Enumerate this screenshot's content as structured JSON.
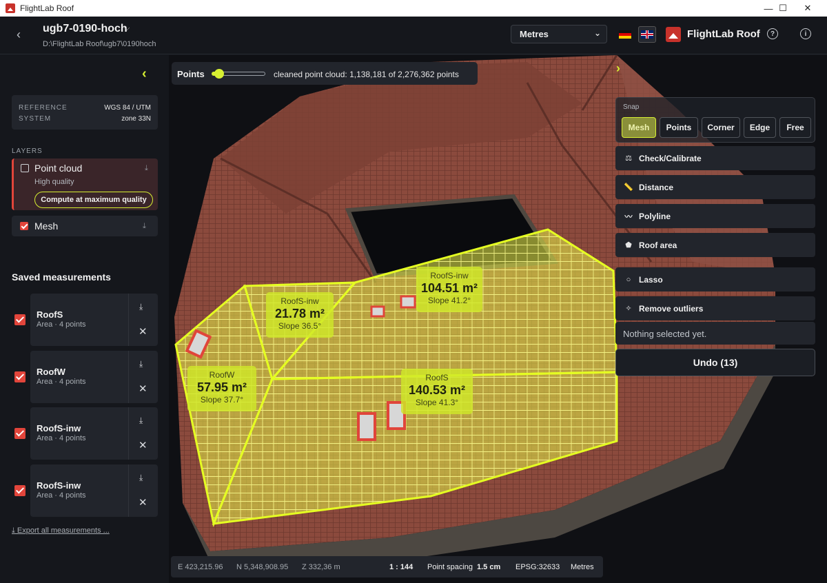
{
  "window": {
    "title": "FlightLab Roof",
    "minimize": "—",
    "maximize": "☐",
    "close": "✕"
  },
  "header": {
    "back": "‹",
    "project_name": "ugb7-0190-hoch",
    "project_caret": "⌵",
    "project_path": "D:\\FlightLab Roof\\ugb7\\0190hoch",
    "units_value": "Metres",
    "brand_name": "FlightLab Roof",
    "help_icon": "?",
    "info_icon": "i"
  },
  "left": {
    "collapse_icon": "‹",
    "reference": {
      "label_1": "REFERENCE",
      "label_2": "SYSTEM",
      "value_1": "WGS 84 / UTM",
      "value_2": "zone 33N"
    },
    "layers_label": "LAYERS",
    "point_cloud": {
      "title": "Point cloud",
      "quality": "High quality",
      "compute_label": "Compute at maximum quality",
      "checked": false
    },
    "mesh": {
      "title": "Mesh",
      "checked": true
    },
    "saved_title": "Saved measurements",
    "measurements": [
      {
        "name": "RoofS",
        "desc": "Area · 4 points"
      },
      {
        "name": "RoofW",
        "desc": "Area · 4 points"
      },
      {
        "name": "RoofS-inw",
        "desc": "Area · 4 points"
      },
      {
        "name": "RoofS-inw",
        "desc": "Area · 4 points"
      }
    ],
    "export_label": "⤓ Export all measurements ..."
  },
  "points_bar": {
    "label": "Points",
    "text": "cleaned point cloud: 1,138,181 of 2,276,362 points",
    "slider_fraction": 0.1
  },
  "snap": {
    "label": "Snap",
    "options": [
      "Mesh",
      "Points",
      "Corner",
      "Edge",
      "Free"
    ],
    "selected": "Mesh"
  },
  "tools": [
    {
      "label": "Check/Calibrate",
      "icon": "⚖"
    },
    {
      "label": "Distance",
      "icon": "📏"
    },
    {
      "label": "Polyline",
      "icon": "〰"
    },
    {
      "label": "Roof area",
      "icon": "⬟"
    },
    {
      "label": "Lasso",
      "icon": "○"
    },
    {
      "label": "Remove outliers",
      "icon": "✧"
    }
  ],
  "status_text": "Nothing selected yet.",
  "undo_label": "Undo (13)",
  "areas": [
    {
      "name": "RoofS-inw",
      "area": "104.51 m²",
      "slope": "Slope 41.2°"
    },
    {
      "name": "RoofS-inw",
      "area": "21.78 m²",
      "slope": "Slope 36.5°"
    },
    {
      "name": "RoofW",
      "area": "57.95 m²",
      "slope": "Slope 37.7°"
    },
    {
      "name": "RoofS",
      "area": "140.53 m²",
      "slope": "Slope 41.3°"
    }
  ],
  "bottom": {
    "easting": "E 423,215.96",
    "northing": "N 5,348,908.95",
    "z": "Z 332,36 m",
    "scale": "1 : 144",
    "spacing_label": "Point spacing",
    "spacing_value": "1.5 cm",
    "epsg": "EPSG:32633",
    "units": "Metres"
  },
  "colors": {
    "accent": "#d7f032",
    "brand": "#c8322b",
    "roof_tile": "#8e4a3c",
    "checkbox": "#e2453b"
  }
}
